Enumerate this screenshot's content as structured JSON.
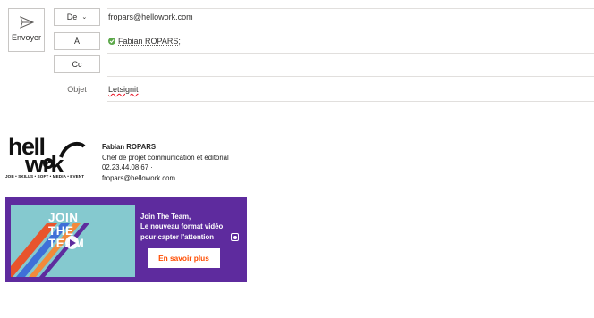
{
  "compose": {
    "send_label": "Envoyer",
    "from_button": "De",
    "from_value": "fropars@hellowork.com",
    "to_button": "À",
    "to_recipient": "Fabian ROPARS;",
    "cc_button": "Cc",
    "cc_value": "",
    "subject_label": "Objet",
    "subject_value": "Letsignit"
  },
  "signature": {
    "logo_text_1": "hell",
    "logo_text_2": "wrk",
    "logo_tagline": "JOB • SKILLS • SOFT • MEDIA • EVENT",
    "name": "Fabian ROPARS",
    "job_title": "Chef de projet communication et éditorial",
    "phone": "02.23.44.08.67 ·",
    "email": "fropars@hellowork.com"
  },
  "banner": {
    "thumb_title_1": "JOIN",
    "thumb_title_2": "THE",
    "thumb_title_3": "TEAM",
    "line_1": "Join The Team,",
    "line_2": "Le nouveau format vidéo",
    "line_3": "pour capter l'attention",
    "cta": "En savoir plus"
  },
  "colors": {
    "banner_bg": "#5e2b9e",
    "thumb_bg": "#85c9cf",
    "cta_text": "#ff4c00",
    "check": "#5ca84a"
  }
}
